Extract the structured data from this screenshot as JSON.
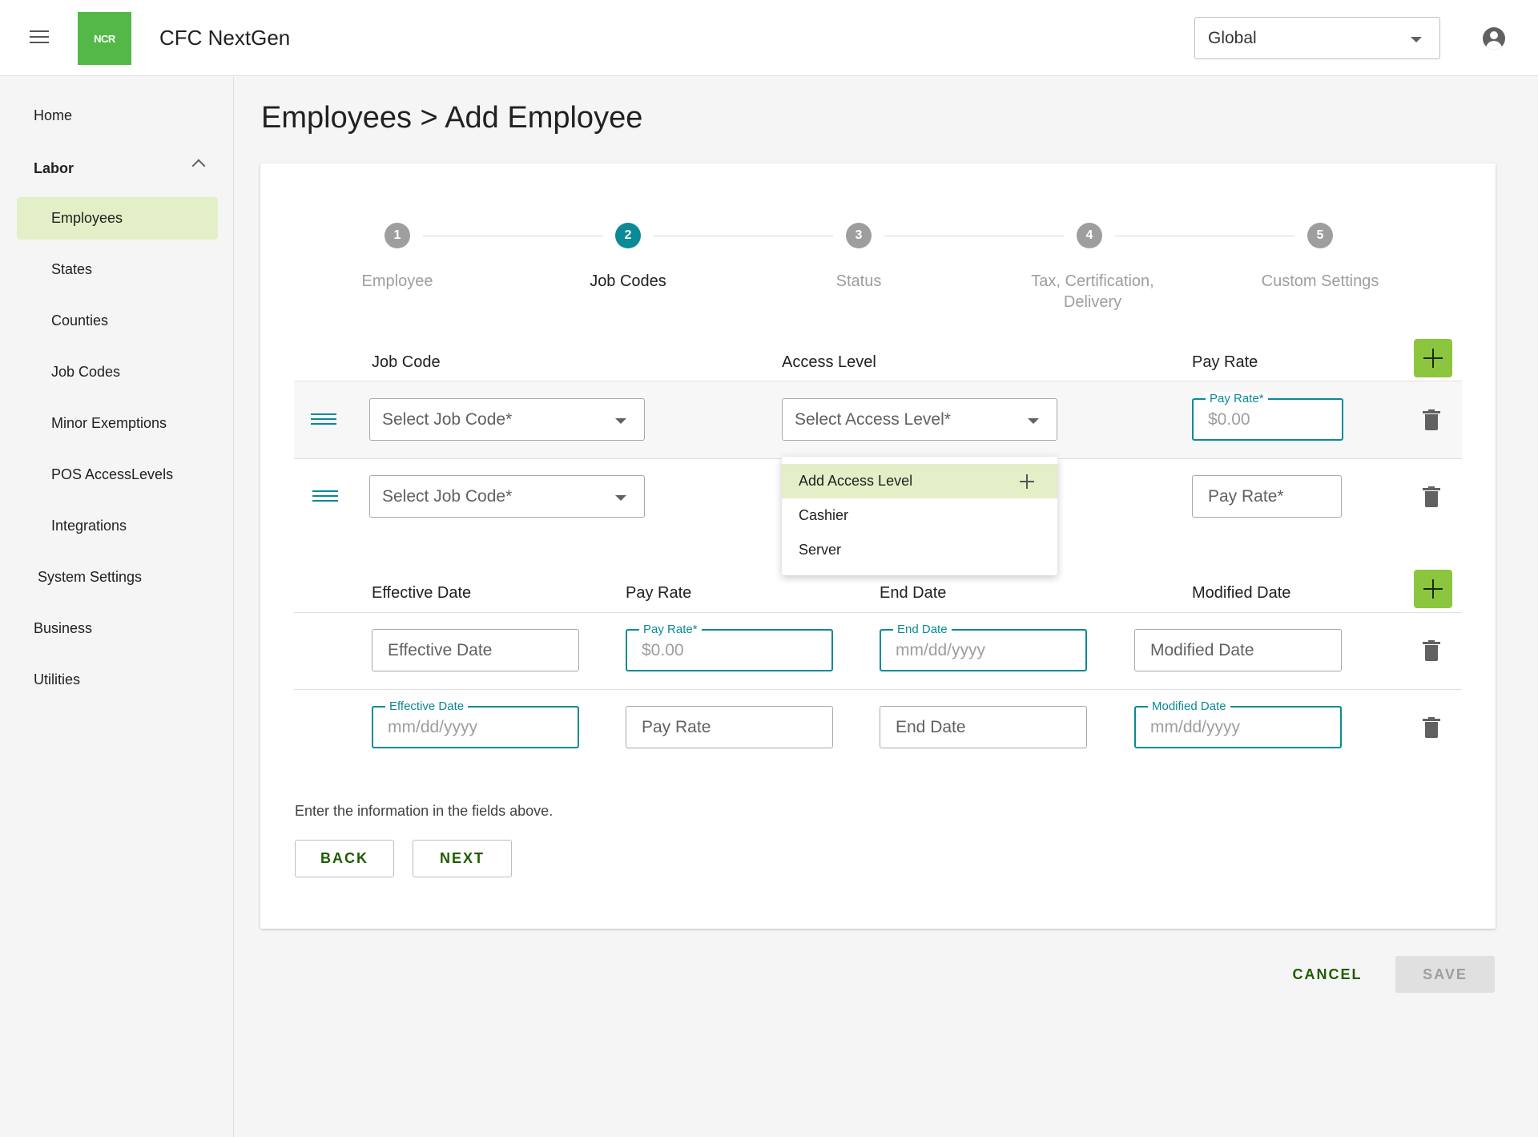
{
  "header": {
    "logo_text": "NCR",
    "app_title": "CFC NextGen",
    "scope_select": "Global"
  },
  "sidebar": {
    "home": "Home",
    "labor": "Labor",
    "labor_items": [
      "Employees",
      "States",
      "Counties",
      "Job Codes",
      "Minor Exemptions",
      "POS AccessLevels",
      "Integrations"
    ],
    "system_settings": "System Settings",
    "business": "Business",
    "utilities": "Utilities",
    "active_item": "Employees"
  },
  "page": {
    "title": "Employees > Add Employee"
  },
  "stepper": {
    "active_step": 2,
    "steps": [
      {
        "number": "1",
        "label": "Employee"
      },
      {
        "number": "2",
        "label": "Job Codes"
      },
      {
        "number": "3",
        "label": "Status"
      },
      {
        "number": "4",
        "label_line1": "Tax, Certification,",
        "label_line2": "Delivery"
      },
      {
        "number": "5",
        "label": "Custom Settings"
      }
    ]
  },
  "job_codes": {
    "headers": {
      "job_code": "Job Code",
      "access_level": "Access Level",
      "pay_rate": "Pay Rate"
    },
    "rows": [
      {
        "job_code_placeholder": "Select Job Code*",
        "access_level_placeholder": "Select Access Level*",
        "pay_rate_label": "Pay Rate*",
        "pay_rate_value": "$0.00"
      },
      {
        "job_code_placeholder": "Select Job Code*",
        "pay_rate_placeholder": "Pay Rate*"
      }
    ],
    "access_menu": [
      "Add Access Level",
      "Cashier",
      "Server"
    ]
  },
  "rates": {
    "headers": {
      "effective_date": "Effective Date",
      "pay_rate": "Pay Rate",
      "end_date": "End Date",
      "modified_date": "Modified Date"
    },
    "rows": [
      {
        "effective_date": "Effective Date",
        "pay_rate_label": "Pay Rate*",
        "pay_rate_value": "$0.00",
        "end_date_label": "End Date",
        "end_date_value": "mm/dd/yyyy",
        "modified_date": "Modified Date"
      },
      {
        "effective_date_label": "Effective Date",
        "effective_date_value": "mm/dd/yyyy",
        "pay_rate": "Pay Rate",
        "end_date": "End Date",
        "modified_date_label": "Modified Date",
        "modified_date_value": "mm/dd/yyyy"
      }
    ]
  },
  "footer": {
    "hint": "Enter the information in the fields above.",
    "back": "BACK",
    "next": "NEXT",
    "cancel": "CANCEL",
    "save": "SAVE"
  },
  "colors": {
    "brand_green": "#54b848",
    "accent_teal": "#0a8a94",
    "action_green": "#8cc63e",
    "highlight": "#e3efc7"
  }
}
